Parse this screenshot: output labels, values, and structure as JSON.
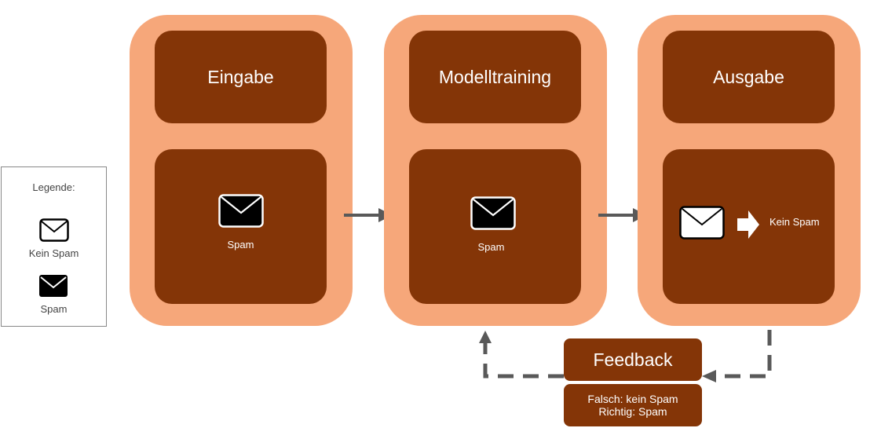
{
  "legend": {
    "title": "Legende:",
    "items": [
      {
        "icon": "envelope-outline-icon",
        "label": "Kein Spam"
      },
      {
        "icon": "envelope-filled-icon",
        "label": "Spam"
      }
    ]
  },
  "stages": [
    {
      "title": "Eingabe",
      "content_label": "Spam",
      "icon": "envelope-filled-icon"
    },
    {
      "title": "Modelltraining",
      "content_label": "Spam",
      "icon": "envelope-filled-icon"
    },
    {
      "title": "Ausgabe",
      "content_label": "Kein Spam",
      "icon": "envelope-outline-icon"
    }
  ],
  "feedback": {
    "title": "Feedback",
    "line1": "Falsch: kein Spam",
    "line2": "Richtig: Spam"
  },
  "colors": {
    "outer": "#f6a77a",
    "inner": "#843507",
    "arrow": "#595959"
  }
}
